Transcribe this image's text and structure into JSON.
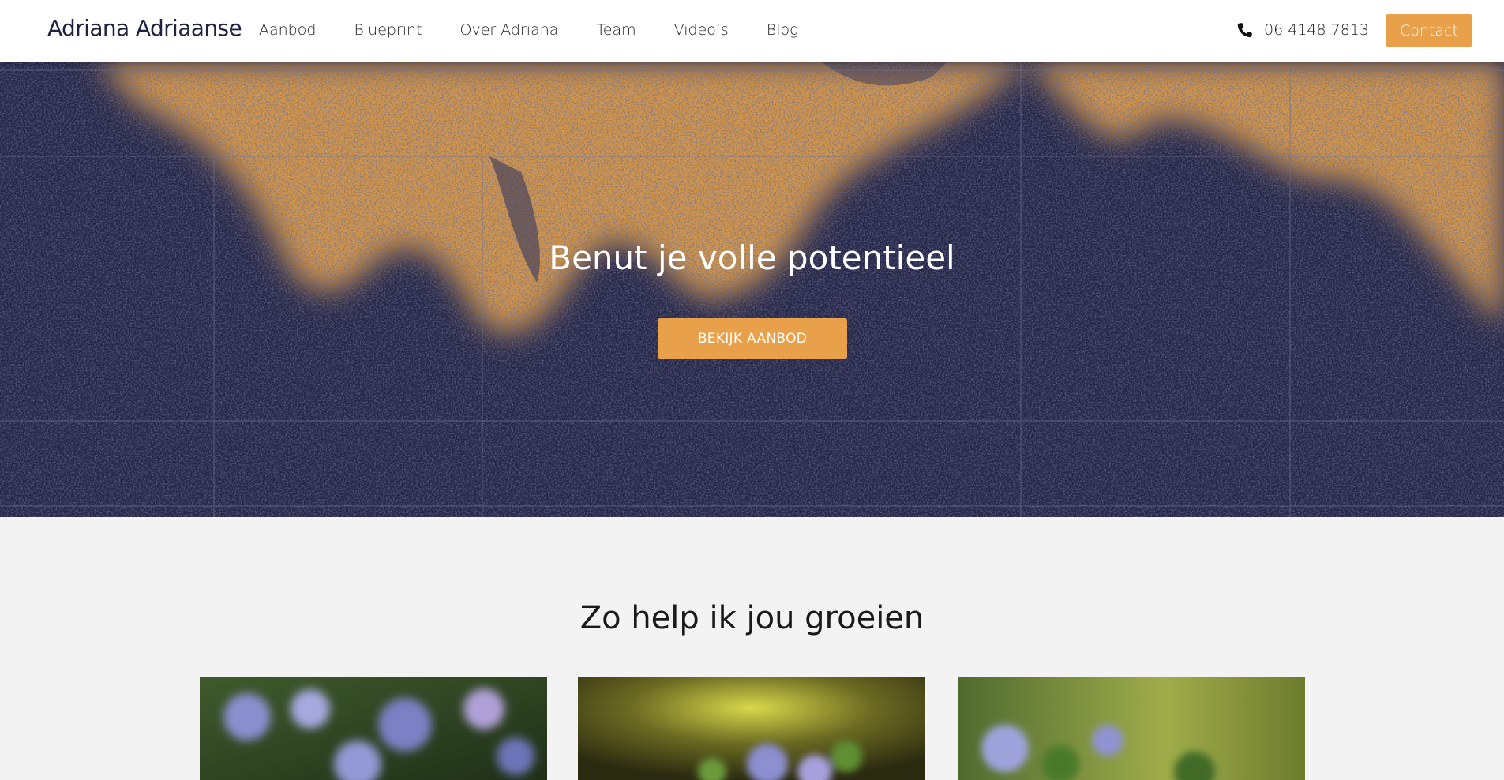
{
  "nav": {
    "brand": "Adriana Adriaanse",
    "menu": [
      "Aanbod",
      "Blueprint",
      "Over Adriana",
      "Team",
      "Video’s",
      "Blog"
    ],
    "phone": "06 4148 7813",
    "phone_icon": "phone-icon",
    "contact": "Contact"
  },
  "hero": {
    "title": "Benut je volle potentieel",
    "button": "BEKIJK AANBOD"
  },
  "section": {
    "title": "Zo help ik jou groeien"
  },
  "colors": {
    "accent": "#e8a14a",
    "hero_bg": "#242546",
    "page_bg": "#f3f3f3"
  }
}
